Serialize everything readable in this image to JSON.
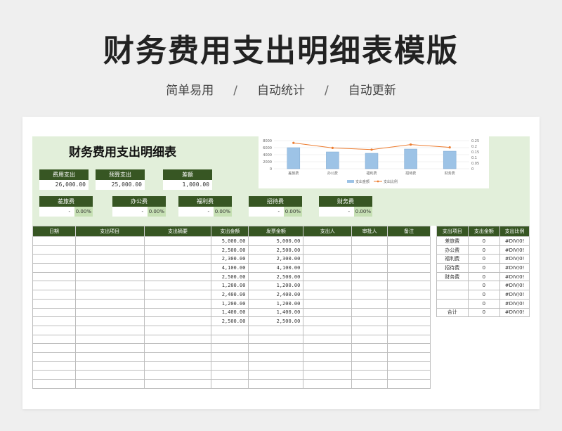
{
  "hero": {
    "title": "财务费用支出明细表模版",
    "sub1": "简单易用",
    "sub2": "自动统计",
    "sub3": "自动更新",
    "sep": "/"
  },
  "dashboard": {
    "title": "财务费用支出明细表",
    "kpis": [
      {
        "label": "费用支出",
        "value": "26,000.00"
      },
      {
        "label": "预算支出",
        "value": "25,000.00"
      },
      {
        "label": "差额",
        "value": "1,000.00"
      }
    ],
    "categories": [
      {
        "label": "差旅费",
        "amount": "-",
        "pct": "0.00%"
      },
      {
        "label": "办公费",
        "amount": "-",
        "pct": "0.00%"
      },
      {
        "label": "福利费",
        "amount": "-",
        "pct": "0.00%"
      },
      {
        "label": "招待费",
        "amount": "-",
        "pct": "0.00%"
      },
      {
        "label": "财务费",
        "amount": "-",
        "pct": "0.00%"
      }
    ]
  },
  "chart_data": {
    "type": "bar",
    "categories": [
      "差旅费",
      "办公费",
      "福利费",
      "招待费",
      "财务费"
    ],
    "series": [
      {
        "name": "支出金额",
        "kind": "bar",
        "axis": "left",
        "values": [
          6000,
          4800,
          4400,
          5600,
          5000
        ]
      },
      {
        "name": "支出比例",
        "kind": "line",
        "axis": "right",
        "values": [
          0.23,
          0.185,
          0.17,
          0.215,
          0.19
        ]
      }
    ],
    "ylim": [
      0,
      8000
    ],
    "yticks": [
      "8000",
      "6000",
      "4000",
      "2000",
      "0"
    ],
    "y2lim": [
      0,
      0.25
    ],
    "y2ticks": [
      "0.25",
      "0.2",
      "0.15",
      "0.1",
      "0.05",
      "0"
    ],
    "colors": {
      "bar": "#9dc3e6",
      "line": "#ed7d31"
    },
    "legend": "bottom",
    "grid": true
  },
  "main_table": {
    "headers": [
      "日期",
      "支出项目",
      "支出摘要",
      "支出金额",
      "发票金额",
      "支出人",
      "审批人",
      "备注"
    ],
    "rows": [
      [
        "",
        "",
        "",
        "5,000.00",
        "5,000.00",
        "",
        "",
        ""
      ],
      [
        "",
        "",
        "",
        "2,500.00",
        "2,500.00",
        "",
        "",
        ""
      ],
      [
        "",
        "",
        "",
        "2,300.00",
        "2,300.00",
        "",
        "",
        ""
      ],
      [
        "",
        "",
        "",
        "4,100.00",
        "4,100.00",
        "",
        "",
        ""
      ],
      [
        "",
        "",
        "",
        "2,500.00",
        "2,500.00",
        "",
        "",
        ""
      ],
      [
        "",
        "",
        "",
        "1,200.00",
        "1,200.00",
        "",
        "",
        ""
      ],
      [
        "",
        "",
        "",
        "2,400.00",
        "2,400.00",
        "",
        "",
        ""
      ],
      [
        "",
        "",
        "",
        "1,200.00",
        "1,200.00",
        "",
        "",
        ""
      ],
      [
        "",
        "",
        "",
        "1,400.00",
        "1,400.00",
        "",
        "",
        ""
      ],
      [
        "",
        "",
        "",
        "2,500.00",
        "2,500.00",
        "",
        "",
        ""
      ],
      [
        "",
        "",
        "",
        "",
        "",
        "",
        "",
        ""
      ],
      [
        "",
        "",
        "",
        "",
        "",
        "",
        "",
        ""
      ],
      [
        "",
        "",
        "",
        "",
        "",
        "",
        "",
        ""
      ],
      [
        "",
        "",
        "",
        "",
        "",
        "",
        "",
        ""
      ],
      [
        "",
        "",
        "",
        "",
        "",
        "",
        "",
        ""
      ],
      [
        "",
        "",
        "",
        "",
        "",
        "",
        "",
        ""
      ],
      [
        "",
        "",
        "",
        "",
        "",
        "",
        "",
        ""
      ]
    ]
  },
  "side_table": {
    "headers": [
      "支出项目",
      "支出金额",
      "支出比例"
    ],
    "rows": [
      [
        "差旅费",
        "0",
        "#DIV/0!"
      ],
      [
        "办公费",
        "0",
        "#DIV/0!"
      ],
      [
        "福利费",
        "0",
        "#DIV/0!"
      ],
      [
        "招待费",
        "0",
        "#DIV/0!"
      ],
      [
        "财务费",
        "0",
        "#DIV/0!"
      ],
      [
        "",
        "0",
        "#DIV/0!"
      ],
      [
        "",
        "0",
        "#DIV/0!"
      ],
      [
        "",
        "0",
        "#DIV/0!"
      ],
      [
        "合计",
        "0",
        "#DIV/0!"
      ]
    ]
  }
}
